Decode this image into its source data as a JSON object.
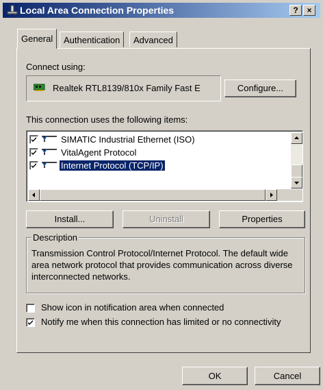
{
  "window": {
    "title": "Local Area Connection Properties",
    "help_button": "?",
    "close_button": "×"
  },
  "tabs": [
    {
      "label": "General",
      "active": true
    },
    {
      "label": "Authentication",
      "active": false
    },
    {
      "label": "Advanced",
      "active": false
    }
  ],
  "general": {
    "connect_using_label": "Connect using:",
    "adapter_name": "Realtek RTL8139/810x Family Fast E",
    "configure_button": "Configure...",
    "items_label": "This connection uses the following items:",
    "items": [
      {
        "label": "SIMATIC Industrial Ethernet (ISO)",
        "checked": true,
        "selected": false
      },
      {
        "label": "VitalAgent Protocol",
        "checked": true,
        "selected": false
      },
      {
        "label": "Internet Protocol (TCP/IP)",
        "checked": true,
        "selected": true
      }
    ],
    "install_button": "Install...",
    "uninstall_button": "Uninstall",
    "properties_button": "Properties",
    "description_label": "Description",
    "description_text": "Transmission Control Protocol/Internet Protocol. The default wide area network protocol that provides communication across diverse interconnected networks.",
    "show_icon_label": "Show icon in notification area when connected",
    "show_icon_checked": false,
    "notify_label": "Notify me when this connection has limited or no connectivity",
    "notify_checked": true
  },
  "footer": {
    "ok_button": "OK",
    "cancel_button": "Cancel"
  },
  "colors": {
    "titlebar_start": "#0a246a",
    "titlebar_end": "#a6caf0",
    "face": "#d4d0c8",
    "selection": "#0a246a"
  }
}
